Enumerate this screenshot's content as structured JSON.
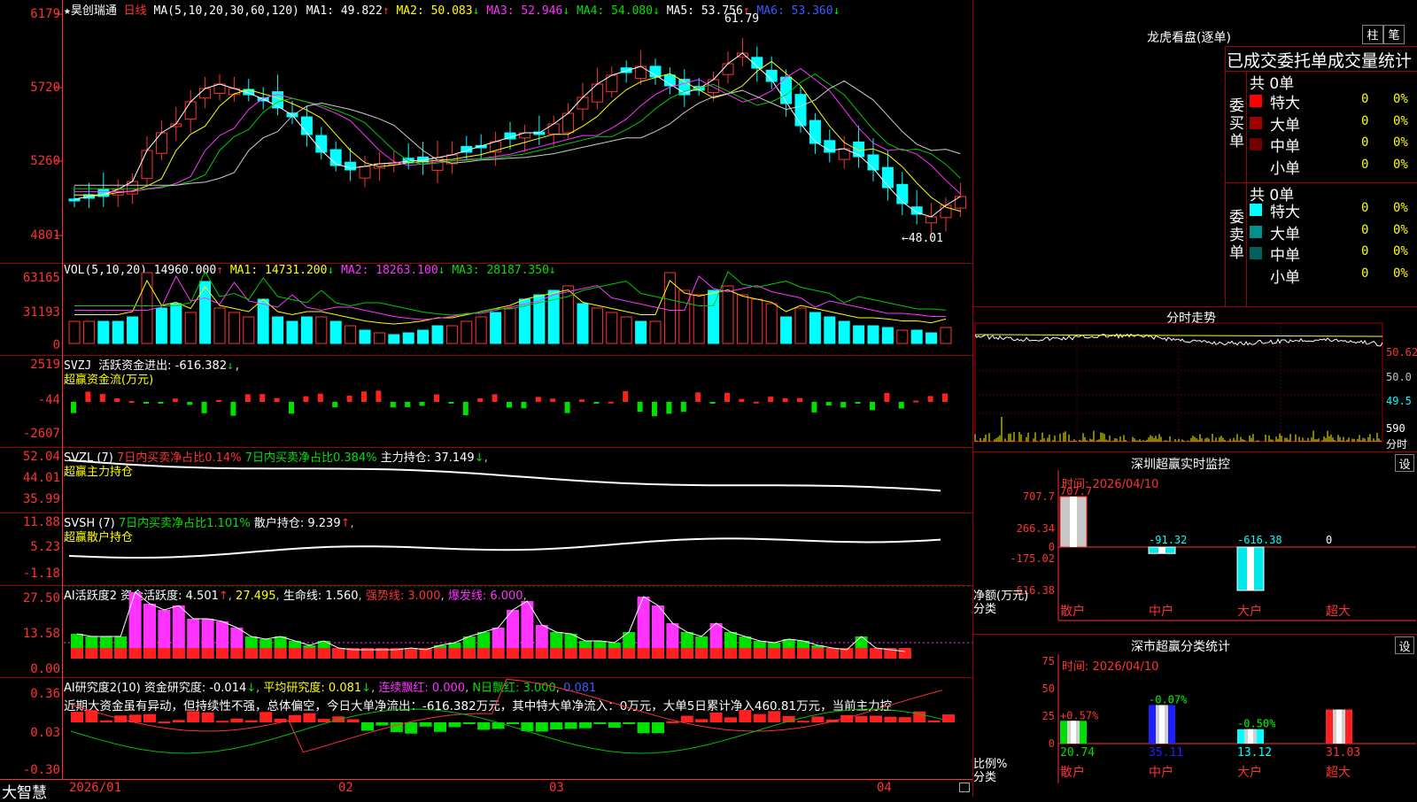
{
  "stock": {
    "star": "★",
    "name": "昊创瑞通",
    "period": "日线"
  },
  "kline_header": {
    "ma_params": "MA(5,10,20,30,60,120)",
    "ma1": "MA1: 49.822",
    "ma2": "MA2: 50.083",
    "ma3": "MA3: 52.946",
    "ma4": "MA4: 54.080",
    "ma5": "MA5: 53.756",
    "ma6": "MA6: 53.360",
    "arrows": [
      "↑",
      "↓",
      "↓",
      "↓",
      "↑",
      "↓"
    ]
  },
  "kline_axis": [
    "6179",
    "5720",
    "5260",
    "4801"
  ],
  "kline_marks": {
    "high": "61.79",
    "low": "←48.01"
  },
  "vol_header": {
    "label": "VOL(5,10,20)",
    "vol": "14960.000",
    "ma1": "MA1: 14731.200",
    "ma2": "MA2: 18263.100",
    "ma3": "MA3: 28187.350",
    "arrows": [
      "↑",
      "↓",
      "↓",
      "↓"
    ]
  },
  "vol_axis": [
    "63165",
    "31193",
    "0"
  ],
  "svzj": {
    "label": "SVZJ",
    "text": "活跃资金进出: -616.382",
    "arrow": "↓",
    "sub": "超赢资金流(万元)",
    "axis": [
      "2519",
      "-44",
      "-2607"
    ]
  },
  "svzl": {
    "label": "SVZL (7)",
    "t1": "7日内买卖净占比0.14%",
    "t2": "7日内买卖净占比0.384%",
    "t3": "主力持仓: 37.149",
    "arrow": "↓",
    "sub": "超赢主力持仓",
    "axis": [
      "52.04",
      "44.01",
      "35.99"
    ]
  },
  "svsh": {
    "label": "SVSH (7)",
    "t1": "7日内买卖净占比1.101%",
    "t2": "散户持仓: 9.239",
    "arrow": "↑",
    "sub": "超赢散户持仓",
    "axis": [
      "11.88",
      "5.23",
      "-1.18"
    ]
  },
  "ai1": {
    "label": "AI活跃度2",
    "t1": "资金活跃度: 4.501",
    "t2": "27.495",
    "t3": "生命线: 1.560",
    "t4": "强势线: 3.000",
    "t5": "爆发线: 6.000",
    "axis": [
      "27.50",
      "13.58",
      "0.00"
    ]
  },
  "ai2": {
    "label": "AI研究度2(10)",
    "t1": "资金研究度: -0.014",
    "t2": "平均研究度: 0.081",
    "t3": "连续飘红: 0.000",
    "t4": "N日飘红: 3.000",
    "t5": "0.081",
    "axis": [
      "0.36",
      "0.03",
      "-0.30"
    ],
    "comment": "近期大资金虽有异动，但持续性不强，总体偏空，今日大单净流出：-616.382万元，其中特大单净流入：0万元，大单5日累计净入460.81万元，当前主力控"
  },
  "xaxis": {
    "brand": "大智慧",
    "dates": [
      "2026/01",
      "02",
      "03",
      "04"
    ]
  },
  "longhu": {
    "title": "龙虎看盘(逐单)",
    "btn1": "柱",
    "btn2": "笔",
    "subtitle": "已成交委托单成交量统计",
    "buy": {
      "side": "委买单",
      "count": "共 0单",
      "rows": [
        {
          "name": "特大",
          "v": "0",
          "p": "0%"
        },
        {
          "name": "大单",
          "v": "0",
          "p": "0%"
        },
        {
          "name": "中单",
          "v": "0",
          "p": "0%"
        },
        {
          "name": "小单",
          "v": "0",
          "p": "0%"
        }
      ]
    },
    "sell": {
      "side": "委卖单",
      "count": "共 0单",
      "rows": [
        {
          "name": "特大",
          "v": "0",
          "p": "0%"
        },
        {
          "name": "大单",
          "v": "0",
          "p": "0%"
        },
        {
          "name": "中单",
          "v": "0",
          "p": "0%"
        },
        {
          "name": "小单",
          "v": "0",
          "p": "0%"
        }
      ]
    },
    "colors": {
      "buy": [
        "#ff0000",
        "#a00000",
        "#700000"
      ],
      "sell": [
        "#00ffff",
        "#009090",
        "#006060"
      ]
    }
  },
  "fenshi": {
    "title": "分时走势",
    "axis": [
      "50.62",
      "50.0",
      "49.5",
      "590",
      "分时"
    ]
  },
  "monitor": {
    "title": "深圳超赢实时监控",
    "btn": "设",
    "time": "时间: 2026/04/10",
    "axis": [
      "707.7",
      "266.34",
      "0",
      "-175.02",
      "-616.38"
    ],
    "unit1": "净额(万元)",
    "unit2": "分类",
    "bars": [
      {
        "cat": "散户",
        "val": "707.7"
      },
      {
        "cat": "中户",
        "val": "-91.32"
      },
      {
        "cat": "大户",
        "val": "-616.38"
      },
      {
        "cat": "超大",
        "val": "0"
      }
    ]
  },
  "classify": {
    "title": "深市超赢分类统计",
    "btn": "设",
    "time": "时间: 2026/04/10",
    "axis": [
      "75",
      "50",
      "25",
      "0"
    ],
    "unit1": "比例%",
    "unit2": "分类",
    "bars": [
      {
        "cat": "散户",
        "top": "+0.57%",
        "val": "20.74",
        "color": "#00dd00"
      },
      {
        "cat": "中户",
        "top": "-0.07%",
        "val": "35.11",
        "color": "#2020ff"
      },
      {
        "cat": "大户",
        "top": "-0.50%",
        "val": "13.12",
        "color": "#00ffff"
      },
      {
        "cat": "超大",
        "top": "",
        "val": "31.03",
        "color": "#ff2020"
      }
    ]
  }
}
